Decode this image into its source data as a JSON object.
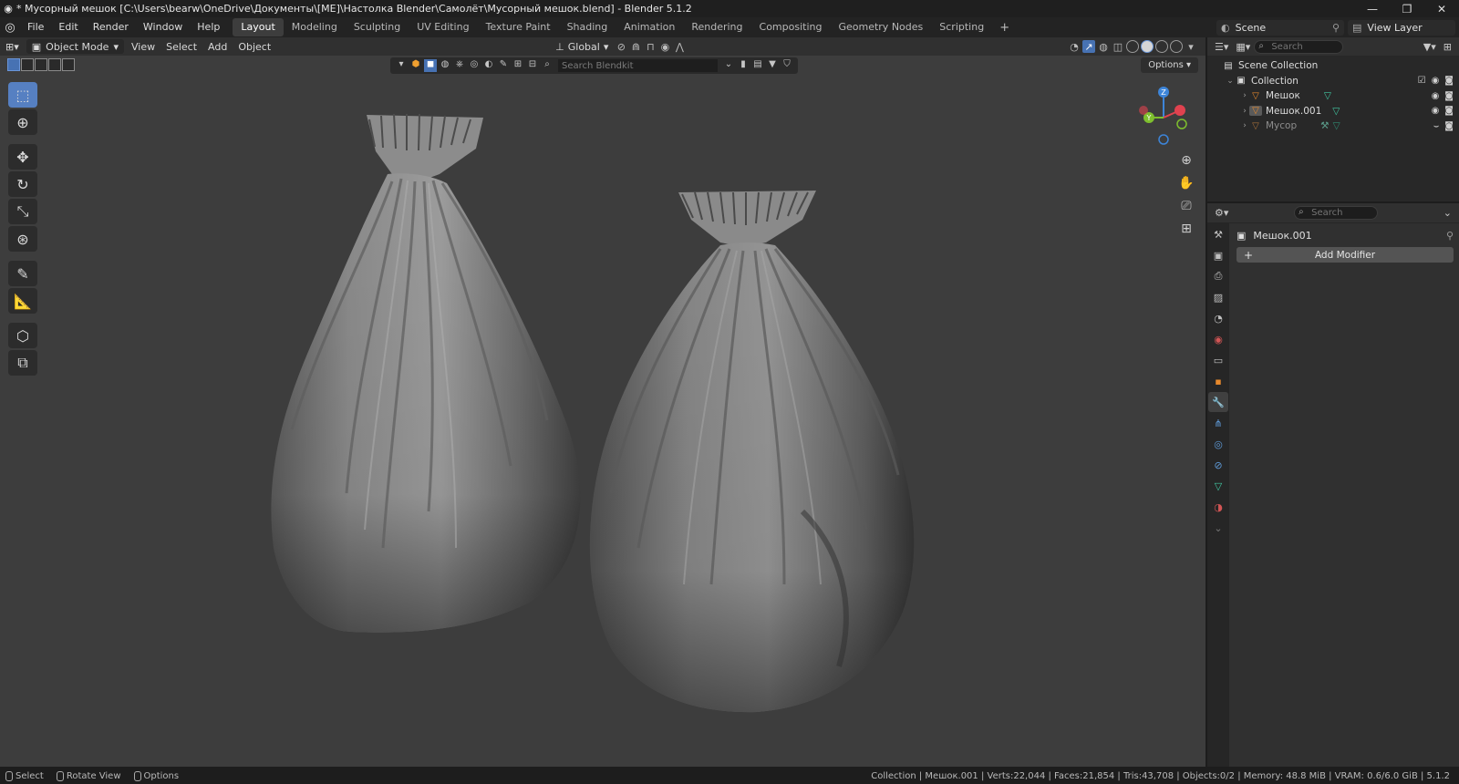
{
  "window": {
    "title": "* Мусорный мешок [C:\\Users\\bearw\\OneDrive\\Документы\\[ME]\\Настолка Blender\\Самолёт\\Мусорный мешок.blend] - Blender 5.1.2",
    "minimize": "—",
    "maximize": "❐",
    "close": "✕"
  },
  "menu": [
    "File",
    "Edit",
    "Render",
    "Window",
    "Help"
  ],
  "workspaces": [
    "Layout",
    "Modeling",
    "Sculpting",
    "UV Editing",
    "Texture Paint",
    "Shading",
    "Animation",
    "Rendering",
    "Compositing",
    "Geometry Nodes",
    "Scripting"
  ],
  "active_workspace": "Layout",
  "scene": {
    "name": "Scene",
    "view_layer": "View Layer"
  },
  "viewport": {
    "mode": "Object Mode",
    "menus": [
      "View",
      "Select",
      "Add",
      "Object"
    ],
    "orientation": "Global",
    "blendkit_placeholder": "Search Blendkit",
    "options_label": "Options",
    "gizmo": {
      "z": "Z",
      "y": "Y",
      "x": "X"
    }
  },
  "outliner": {
    "search_placeholder": "Search",
    "scene_collection": "Scene Collection",
    "collection": "Collection",
    "items": [
      {
        "name": "Мешок",
        "dim": false
      },
      {
        "name": "Мешок.001",
        "dim": false
      },
      {
        "name": "Мусор",
        "dim": true
      }
    ]
  },
  "properties": {
    "search_placeholder": "Search",
    "object_name": "Мешок.001",
    "add_modifier": "Add Modifier"
  },
  "statusbar": {
    "select": "Select",
    "rotate": "Rotate View",
    "options": "Options",
    "stats": "Collection | Мешок.001 | Verts:22,044 | Faces:21,854 | Tris:43,708 | Objects:0/2 | Memory: 48.8 MiB | VRAM: 0.6/6.0 GiB | 5.1.2"
  },
  "colors": {
    "accent": "#4772b3",
    "viewport_bg": "#3d3d3d",
    "axis_x": "#e0424f",
    "axis_y": "#7ebf2e",
    "axis_z": "#3d85d9",
    "mesh_icon": "#41c8a3",
    "object_icon": "#e7892c"
  }
}
